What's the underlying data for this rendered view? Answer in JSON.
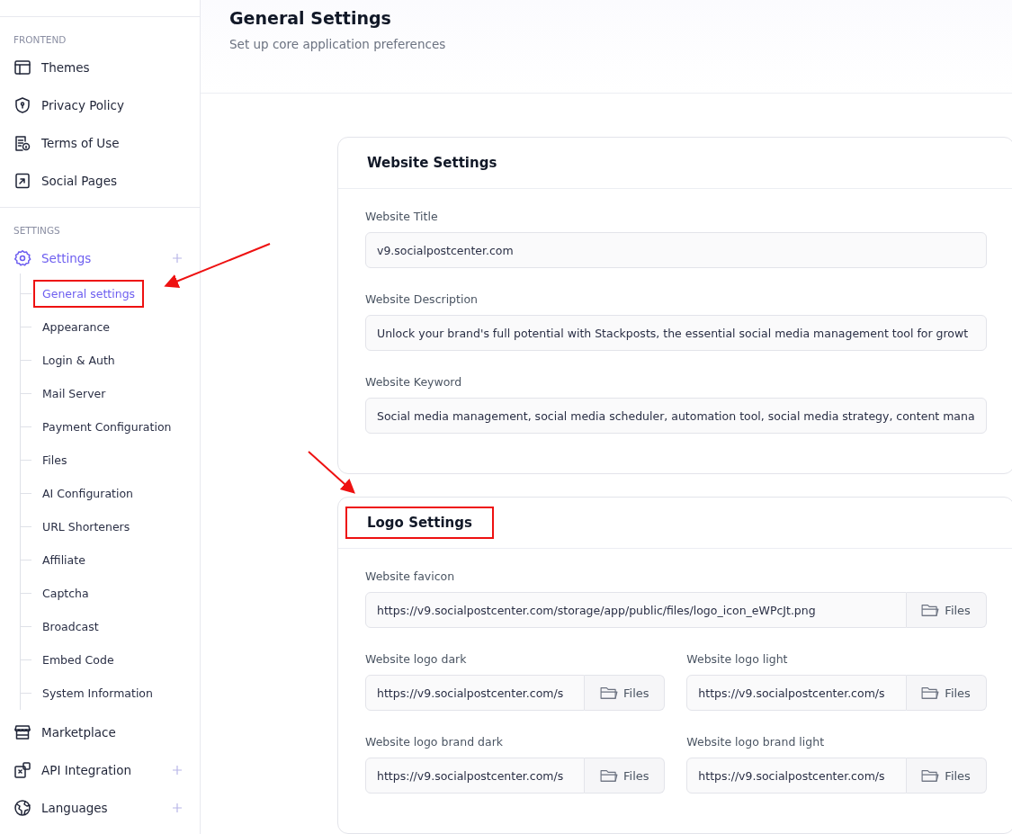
{
  "sidebar": {
    "sections": [
      {
        "label": "FRONTEND",
        "items": [
          {
            "label": "Themes",
            "selected": false,
            "expandable": false
          },
          {
            "label": "Privacy Policy",
            "selected": false,
            "expandable": false
          },
          {
            "label": "Terms of Use",
            "selected": false,
            "expandable": false
          },
          {
            "label": "Social Pages",
            "selected": false,
            "expandable": false
          }
        ]
      },
      {
        "label": "SETTINGS",
        "items": [
          {
            "label": "Settings",
            "selected": true,
            "expandable": true,
            "children": [
              {
                "label": "General settings",
                "selected": true,
                "highlighted": true
              },
              {
                "label": "Appearance",
                "selected": false,
                "highlighted": false
              },
              {
                "label": "Login & Auth",
                "selected": false,
                "highlighted": false
              },
              {
                "label": "Mail Server",
                "selected": false,
                "highlighted": false
              },
              {
                "label": "Payment Configuration",
                "selected": false,
                "highlighted": false
              },
              {
                "label": "Files",
                "selected": false,
                "highlighted": false
              },
              {
                "label": "AI Configuration",
                "selected": false,
                "highlighted": false
              },
              {
                "label": "URL Shorteners",
                "selected": false,
                "highlighted": false
              },
              {
                "label": "Affiliate",
                "selected": false,
                "highlighted": false
              },
              {
                "label": "Captcha",
                "selected": false,
                "highlighted": false
              },
              {
                "label": "Broadcast",
                "selected": false,
                "highlighted": false
              },
              {
                "label": "Embed Code",
                "selected": false,
                "highlighted": false
              },
              {
                "label": "System Information",
                "selected": false,
                "highlighted": false
              }
            ]
          },
          {
            "label": "Marketplace",
            "selected": false,
            "expandable": false
          },
          {
            "label": "API Integration",
            "selected": false,
            "expandable": true
          },
          {
            "label": "Languages",
            "selected": false,
            "expandable": true
          }
        ]
      }
    ]
  },
  "header": {
    "title": "General Settings",
    "subtitle": "Set up core application preferences"
  },
  "cards": [
    {
      "title": "Website Settings",
      "highlighted": false,
      "rows": [
        [
          {
            "label": "Website Title",
            "value": "v9.socialpostcenter.com",
            "kind": "text"
          }
        ],
        [
          {
            "label": "Website Description",
            "value": "Unlock your brand's full potential with Stackposts, the essential social media management tool for growt",
            "kind": "text"
          }
        ],
        [
          {
            "label": "Website Keyword",
            "value": "Social media management, social media scheduler, automation tool, social media strategy, content mana",
            "kind": "text"
          }
        ]
      ]
    },
    {
      "title": "Logo Settings",
      "highlighted": true,
      "rows": [
        [
          {
            "label": "Website favicon",
            "value": "https://v9.socialpostcenter.com/storage/app/public/files/logo_icon_eWPcJt.png",
            "kind": "file",
            "button": "Files"
          }
        ],
        [
          {
            "label": "Website logo dark",
            "value": "https://v9.socialpostcenter.com/s",
            "kind": "file",
            "button": "Files"
          },
          {
            "label": "Website logo light",
            "value": "https://v9.socialpostcenter.com/s",
            "kind": "file",
            "button": "Files"
          }
        ],
        [
          {
            "label": "Website logo brand dark",
            "value": "https://v9.socialpostcenter.com/s",
            "kind": "file",
            "button": "Files"
          },
          {
            "label": "Website logo brand light",
            "value": "https://v9.socialpostcenter.com/s",
            "kind": "file",
            "button": "Files"
          }
        ]
      ]
    }
  ]
}
